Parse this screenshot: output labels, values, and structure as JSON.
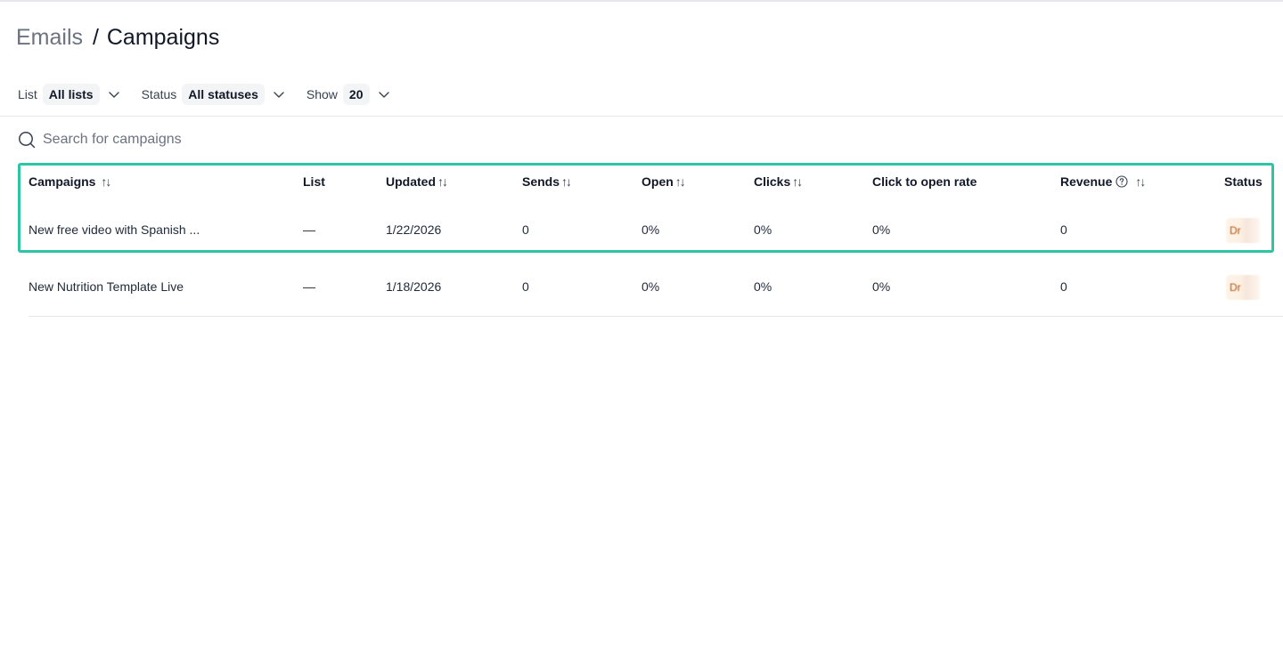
{
  "breadcrumb": {
    "parent": "Emails",
    "separator": "/",
    "current": "Campaigns"
  },
  "filters": {
    "list": {
      "label": "List",
      "value": "All lists"
    },
    "status": {
      "label": "Status",
      "value": "All statuses"
    },
    "show": {
      "label": "Show",
      "value": "20"
    }
  },
  "search": {
    "placeholder": "Search for campaigns",
    "value": ""
  },
  "table": {
    "headers": {
      "campaigns": "Campaigns",
      "list": "List",
      "updated": "Updated",
      "sends": "Sends",
      "open": "Open",
      "clicks": "Clicks",
      "click_to_open": "Click to open rate",
      "revenue": "Revenue",
      "status": "Status"
    },
    "sort_glyph": "↑↓",
    "rows": [
      {
        "campaign": "New free video with Spanish ...",
        "list": "—",
        "updated": "1/22/2026",
        "sends": "0",
        "open": "0%",
        "clicks": "0%",
        "click_to_open": "0%",
        "revenue": "0",
        "status": "Dr"
      },
      {
        "campaign": "New Nutrition Template Live",
        "list": "—",
        "updated": "1/18/2026",
        "sends": "0",
        "open": "0%",
        "clicks": "0%",
        "click_to_open": "0%",
        "revenue": "0",
        "status": "Dr"
      }
    ]
  },
  "icons": {
    "search": "search-icon",
    "chevron": "chevron-down-icon",
    "help": "help-circle-icon"
  },
  "colors": {
    "highlight": "#2ec4a6",
    "status_text": "#b45309",
    "muted_text": "#6b7280"
  }
}
